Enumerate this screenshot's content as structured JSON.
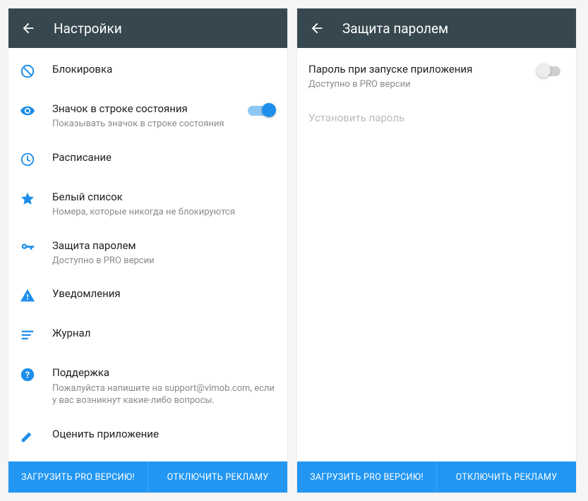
{
  "left": {
    "title": "Настройки",
    "items": [
      {
        "icon": "block",
        "title": "Блокировка"
      },
      {
        "icon": "eye",
        "title": "Значок в строке состояния",
        "sub": "Показывать значок в строке состояния",
        "switch": "on"
      },
      {
        "icon": "clock",
        "title": "Расписание"
      },
      {
        "icon": "star",
        "title": "Белый список",
        "sub": "Номера, которые никогда не блокируются"
      },
      {
        "icon": "key",
        "title": "Защита паролем",
        "sub": "Доступно в PRO версии"
      },
      {
        "icon": "warning",
        "title": "Уведомления"
      },
      {
        "icon": "lines",
        "title": "Журнал"
      },
      {
        "icon": "help",
        "title": "Поддержка",
        "sub": "Пожалуйста напишите на support@vlmob.com, если у вас возникнут какие-либо вопросы."
      },
      {
        "icon": "rate",
        "title": "Оценить приложение"
      }
    ],
    "buttons": {
      "pro": "ЗАГРУЗИТЬ PRO ВЕРСИЮ!",
      "ads": "ОТКЛЮЧИТЬ РЕКЛАМУ"
    }
  },
  "right": {
    "title": "Защита паролем",
    "row1": {
      "title": "Пароль при запуске приложения",
      "sub": "Доступно в PRO версии"
    },
    "row2": {
      "title": "Установить пароль"
    },
    "buttons": {
      "pro": "ЗАГРУЗИТЬ PRO ВЕРСИЮ!",
      "ads": "ОТКЛЮЧИТЬ РЕКЛАМУ"
    }
  }
}
